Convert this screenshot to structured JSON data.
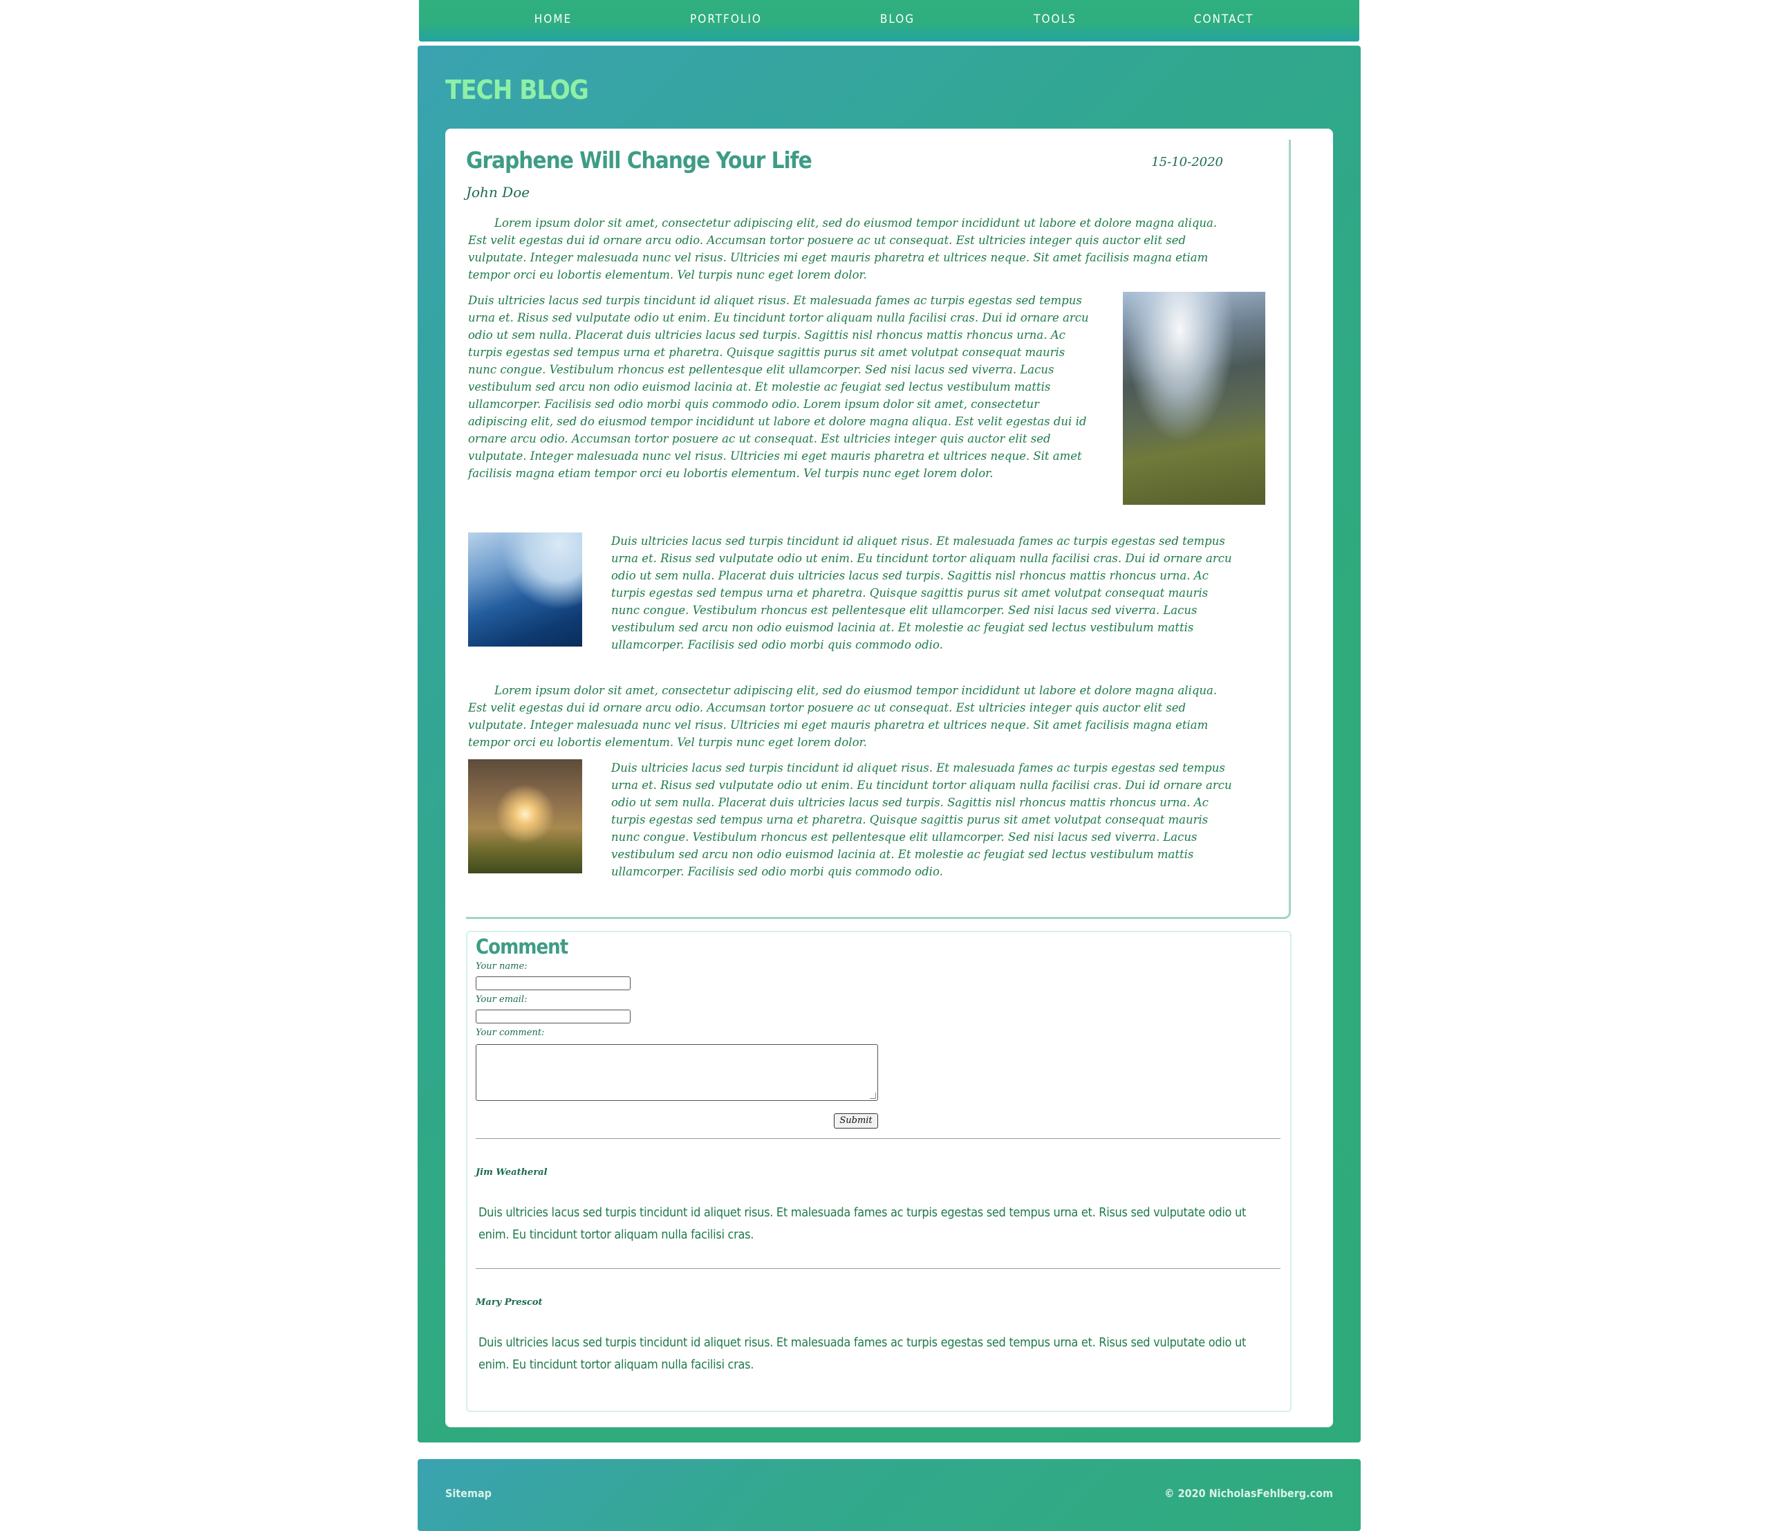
{
  "nav": {
    "items": [
      "HOME",
      "PORTFOLIO",
      "BLOG",
      "TOOLS",
      "CONTACT"
    ]
  },
  "site": {
    "title": "TECH BLOG"
  },
  "article": {
    "title": "Graphene Will Change Your Life",
    "date": "15-10-2020",
    "author": "John Doe",
    "paragraphs": [
      "Lorem ipsum dolor sit amet, consectetur adipiscing elit, sed do eiusmod tempor incididunt ut labore et dolore magna aliqua. Est velit egestas dui id ornare arcu odio. Accumsan tortor posuere ac ut consequat. Est ultricies integer quis auctor elit sed vulputate. Integer malesuada nunc vel risus. Ultricies mi eget mauris pharetra et ultrices neque. Sit amet facilisis magna etiam tempor orci eu lobortis elementum. Vel turpis nunc eget lorem dolor.",
      "Duis ultricies lacus sed turpis tincidunt id aliquet risus. Et malesuada fames ac turpis egestas sed tempus urna et. Risus sed vulputate odio ut enim. Eu tincidunt tortor aliquam nulla facilisi cras. Dui id ornare arcu odio ut sem nulla. Placerat duis ultricies lacus sed turpis. Sagittis nisl rhoncus mattis rhoncus urna. Ac turpis egestas sed tempus urna et pharetra. Quisque sagittis purus sit amet volutpat consequat mauris nunc congue. Vestibulum rhoncus est pellentesque elit ullamcorper. Sed nisi lacus sed viverra. Lacus vestibulum sed arcu non odio euismod lacinia at. Et molestie ac feugiat sed lectus vestibulum mattis ullamcorper. Facilisis sed odio morbi quis commodo odio. Lorem ipsum dolor sit amet, consectetur adipiscing elit, sed do eiusmod tempor incididunt ut labore et dolore magna aliqua. Est velit egestas dui id ornare arcu odio. Accumsan tortor posuere ac ut consequat. Est ultricies integer quis auctor elit sed vulputate. Integer malesuada nunc vel risus. Ultricies mi eget mauris pharetra et ultrices neque. Sit amet facilisis magna etiam tempor orci eu lobortis elementum. Vel turpis nunc eget lorem dolor.",
      "Duis ultricies lacus sed turpis tincidunt id aliquet risus. Et malesuada fames ac turpis egestas sed tempus urna et. Risus sed vulputate odio ut enim. Eu tincidunt tortor aliquam nulla facilisi cras. Dui id ornare arcu odio ut sem nulla. Placerat duis ultricies lacus sed turpis. Sagittis nisl rhoncus mattis rhoncus urna. Ac turpis egestas sed tempus urna et pharetra. Quisque sagittis purus sit amet volutpat consequat mauris nunc congue. Vestibulum rhoncus est pellentesque elit ullamcorper. Sed nisi lacus sed viverra. Lacus vestibulum sed arcu non odio euismod lacinia at. Et molestie ac feugiat sed lectus vestibulum mattis ullamcorper. Facilisis sed odio morbi quis commodo odio.",
      "Lorem ipsum dolor sit amet, consectetur adipiscing elit, sed do eiusmod tempor incididunt ut labore et dolore magna aliqua. Est velit egestas dui id ornare arcu odio. Accumsan tortor posuere ac ut consequat. Est ultricies integer quis auctor elit sed vulputate. Integer malesuada nunc vel risus. Ultricies mi eget mauris pharetra et ultrices neque. Sit amet facilisis magna etiam tempor orci eu lobortis elementum. Vel turpis nunc eget lorem dolor.",
      "Duis ultricies lacus sed turpis tincidunt id aliquet risus. Et malesuada fames ac turpis egestas sed tempus urna et. Risus sed vulputate odio ut enim. Eu tincidunt tortor aliquam nulla facilisi cras. Dui id ornare arcu odio ut sem nulla. Placerat duis ultricies lacus sed turpis. Sagittis nisl rhoncus mattis rhoncus urna. Ac turpis egestas sed tempus urna et pharetra. Quisque sagittis purus sit amet volutpat consequat mauris nunc congue. Vestibulum rhoncus est pellentesque elit ullamcorper. Sed nisi lacus sed viverra. Lacus vestibulum sed arcu non odio euismod lacinia at. Et molestie ac feugiat sed lectus vestibulum mattis ullamcorper. Facilisis sed odio morbi quis commodo odio."
    ]
  },
  "comment_form": {
    "heading": "Comment",
    "name_label": "Your name:",
    "email_label": "Your email:",
    "comment_label": "Your comment:",
    "name_value": "",
    "email_value": "",
    "comment_value": "",
    "submit_label": "Submit"
  },
  "comments": [
    {
      "author": "Jim Weatheral",
      "text": "Duis ultricies lacus sed turpis tincidunt id aliquet risus. Et malesuada fames ac turpis egestas sed tempus urna et. Risus sed vulputate odio ut enim. Eu tincidunt tortor aliquam nulla facilisi cras."
    },
    {
      "author": "Mary Prescot",
      "text": "Duis ultricies lacus sed turpis tincidunt id aliquet risus. Et malesuada fames ac turpis egestas sed tempus urna et. Risus sed vulputate odio ut enim. Eu tincidunt tortor aliquam nulla facilisi cras."
    }
  ],
  "footer": {
    "sitemap": "Sitemap",
    "copyright": "© 2020 NicholasFehlberg.com"
  },
  "colors": {
    "nav_bg": "#2fb07e",
    "panel_accent": "#3aa3b0",
    "title_green": "#8ef0a6",
    "heading_green": "#3e9c86",
    "text_green": "#1e7a4a"
  },
  "icons": {
    "images": [
      "mountain-photo",
      "ocean-wave-photo",
      "forest-sunset-photo"
    ]
  }
}
